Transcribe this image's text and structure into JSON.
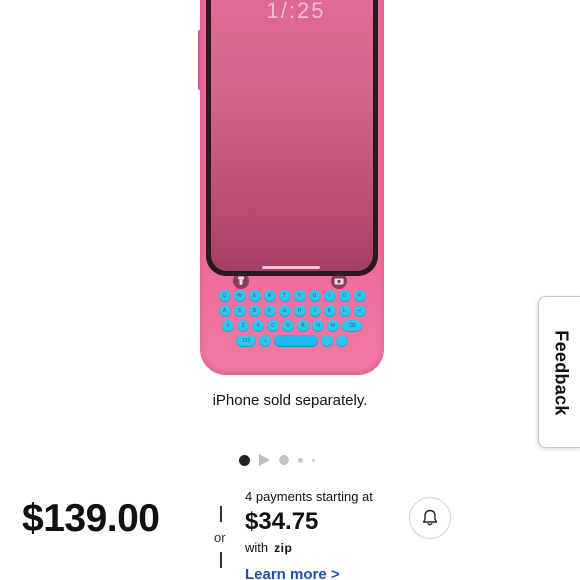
{
  "product": {
    "lock_time": "1/:25",
    "keyboard_rows": [
      [
        "Q",
        "W",
        "E",
        "R",
        "T",
        "Y",
        "U",
        "I",
        "O",
        "P"
      ],
      [
        "A",
        "S",
        "D",
        "F",
        "G",
        "H",
        "J",
        "K",
        "L",
        "↵"
      ],
      [
        "⇧",
        "Z",
        "X",
        "C",
        "V",
        "B",
        "N",
        "M",
        "⌫"
      ],
      [
        "123",
        "☺",
        "",
        "",
        "."
      ]
    ],
    "caption": "iPhone sold separately."
  },
  "carousel": {
    "active_index": 0,
    "count": 5
  },
  "pricing": {
    "price": "$139.00",
    "or_label": "or",
    "installments_label": "4 payments starting at",
    "installment_amount": "$34.75",
    "with_label": "with",
    "provider": "zip",
    "learn_more": "Learn more >"
  },
  "feedback": {
    "label": "Feedback"
  },
  "colors": {
    "case": "#f06a9d",
    "keys": "#33c6ec",
    "link": "#1f4fa8"
  }
}
